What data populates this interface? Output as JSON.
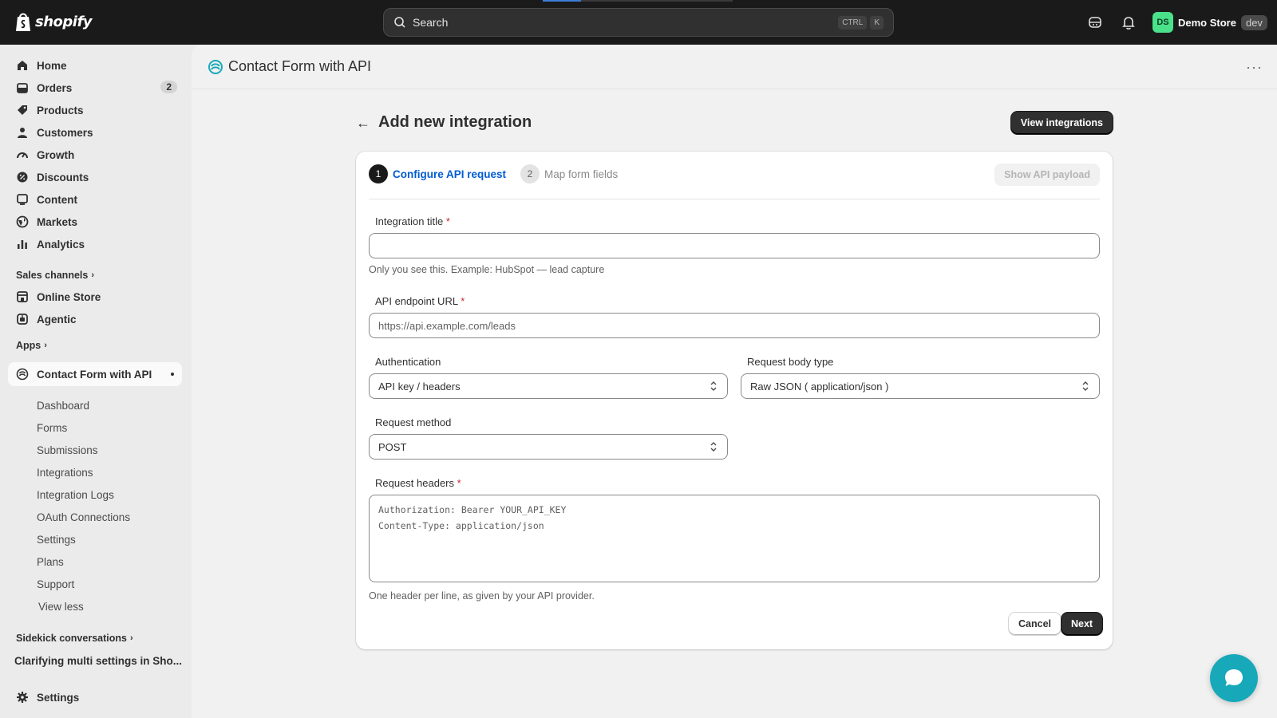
{
  "topbar": {
    "logo_text": "shopify",
    "search_placeholder": "Search",
    "shortcut_keys": [
      "CTRL",
      "K"
    ],
    "avatar_initials": "DS",
    "store_name": "Demo Store",
    "store_badge": "dev",
    "icons": [
      "sidekick-icon",
      "bell-icon"
    ]
  },
  "sidebar": {
    "main_items": [
      {
        "label": "Home",
        "icon": "home-icon"
      },
      {
        "label": "Orders",
        "icon": "orders-icon",
        "badge": "2"
      },
      {
        "label": "Products",
        "icon": "tag-icon"
      },
      {
        "label": "Customers",
        "icon": "person-icon"
      },
      {
        "label": "Growth",
        "icon": "gauge-icon"
      },
      {
        "label": "Discounts",
        "icon": "discount-icon"
      },
      {
        "label": "Content",
        "icon": "content-icon"
      },
      {
        "label": "Markets",
        "icon": "globe-icon"
      },
      {
        "label": "Analytics",
        "icon": "bar-chart-icon"
      }
    ],
    "sales_channels_label": "Sales channels",
    "channels": [
      {
        "label": "Online Store",
        "icon": "store-icon"
      },
      {
        "label": "Agentic",
        "icon": "agentic-icon"
      }
    ],
    "apps_label": "Apps",
    "active_app": "Contact Form with API",
    "app_subitems": [
      "Dashboard",
      "Forms",
      "Submissions",
      "Integrations",
      "Integration Logs",
      "OAuth Connections",
      "Settings",
      "Plans",
      "Support",
      "View less"
    ],
    "sidekick_label": "Sidekick conversations",
    "conversation": "Clarifying multi settings in Sho...",
    "settings_label": "Settings"
  },
  "app_header": {
    "title": "Contact Form with API",
    "more": "···"
  },
  "page": {
    "title": "Add new integration",
    "view_integrations": "View integrations"
  },
  "steps": {
    "step1_num": "1",
    "step1_label": "Configure API request",
    "step2_num": "2",
    "step2_label": "Map form fields",
    "show_payload": "Show API payload"
  },
  "form": {
    "integration_title_label": "Integration title",
    "integration_title_value": "",
    "integration_title_help": "Only you see this. Example: HubSpot — lead capture",
    "endpoint_label": "API endpoint URL",
    "endpoint_placeholder": "https://api.example.com/leads",
    "auth_label": "Authentication",
    "auth_value": "API key / headers",
    "body_type_label": "Request body type",
    "body_type_value": "Raw JSON ( application/json )",
    "method_label": "Request method",
    "method_value": "POST",
    "headers_label": "Request headers",
    "headers_value": "Authorization: Bearer YOUR_API_KEY\nContent-Type: application/json",
    "headers_help": "One header per line, as given by your API provider.",
    "required_mark": "*",
    "cancel_label": "Cancel",
    "next_label": "Next"
  },
  "colors": {
    "topbar": "#1a1a1a",
    "accent_link": "#005bd3",
    "required": "#c5282f",
    "chat": "#17a9b9",
    "avatar": "#4be08a"
  }
}
